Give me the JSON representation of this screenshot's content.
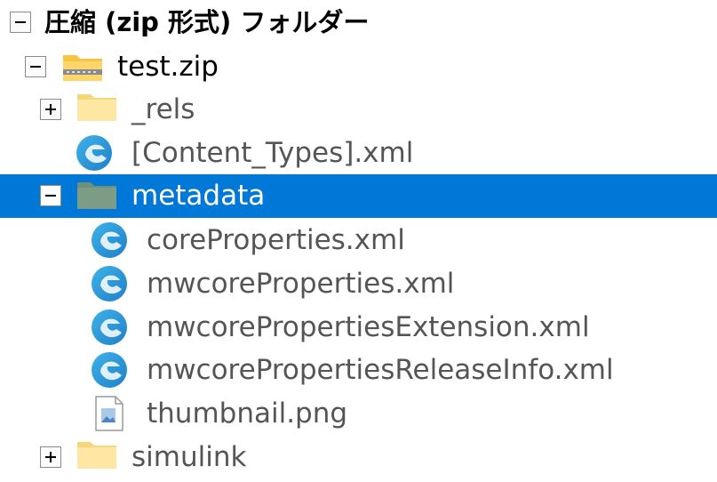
{
  "tree": {
    "root": {
      "label": "圧縮 (zip 形式) フォルダー",
      "expanded": true,
      "icon": "minus-icon"
    },
    "items": [
      {
        "label": "test.zip",
        "icon": "zip-folder-icon",
        "expanded": true
      },
      {
        "label": "_rels",
        "icon": "folder-icon",
        "expanded": false
      },
      {
        "label": "[Content_Types].xml",
        "icon": "edge-xml-icon"
      },
      {
        "label": "metadata",
        "icon": "folder-icon",
        "expanded": true,
        "selected": true
      },
      {
        "label": "coreProperties.xml",
        "icon": "edge-xml-icon"
      },
      {
        "label": "mwcoreProperties.xml",
        "icon": "edge-xml-icon"
      },
      {
        "label": "mwcorePropertiesExtension.xml",
        "icon": "edge-xml-icon"
      },
      {
        "label": "mwcorePropertiesReleaseInfo.xml",
        "icon": "edge-xml-icon"
      },
      {
        "label": "thumbnail.png",
        "icon": "image-file-icon"
      },
      {
        "label": "simulink",
        "icon": "folder-icon",
        "expanded": false
      }
    ]
  },
  "colors": {
    "selection": "#0078d7",
    "text": "#000000",
    "secondary_text": "#555555",
    "folder": "#fde68a"
  }
}
